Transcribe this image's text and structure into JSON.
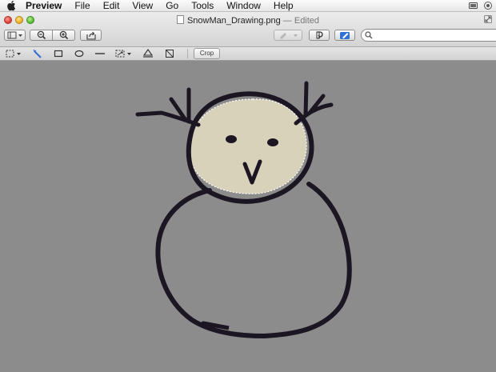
{
  "menubar": {
    "app_name": "Preview",
    "items": [
      "File",
      "Edit",
      "View",
      "Go",
      "Tools",
      "Window",
      "Help"
    ]
  },
  "window": {
    "filename": "SnowMan_Drawing.png",
    "status": "— Edited"
  },
  "markup": {
    "crop_label": "Crop"
  },
  "search": {
    "value": "",
    "placeholder": ""
  },
  "colors": {
    "canvas": "#8c8c8c",
    "selection_fill": "#d9d2bb",
    "ink": "#1b1622",
    "accent": "#2f6fd6"
  }
}
